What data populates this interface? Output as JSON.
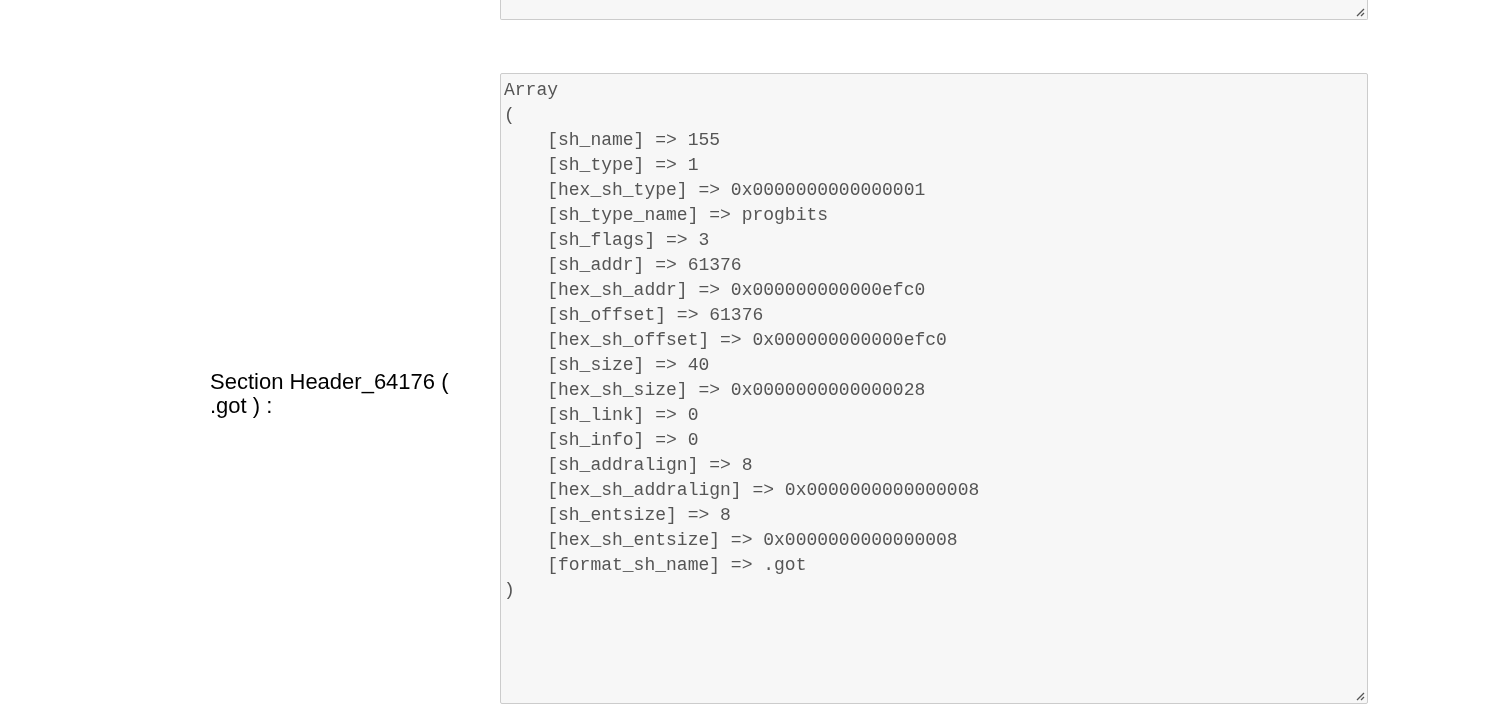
{
  "sections": [
    {
      "label": "Section Header_64176 ( .got ) :",
      "output_lines": [
        "Array",
        "(",
        "    [sh_name] => 155",
        "    [sh_type] => 1",
        "    [hex_sh_type] => 0x0000000000000001",
        "    [sh_type_name] => progbits",
        "    [sh_flags] => 3",
        "    [sh_addr] => 61376",
        "    [hex_sh_addr] => 0x000000000000efc0",
        "    [sh_offset] => 61376",
        "    [hex_sh_offset] => 0x000000000000efc0",
        "    [sh_size] => 40",
        "    [hex_sh_size] => 0x0000000000000028",
        "    [sh_link] => 0",
        "    [sh_info] => 0",
        "    [sh_addralign] => 8",
        "    [hex_sh_addralign] => 0x0000000000000008",
        "    [sh_entsize] => 8",
        "    [hex_sh_entsize] => 0x0000000000000008",
        "    [format_sh_name] => .got",
        ")"
      ]
    }
  ]
}
